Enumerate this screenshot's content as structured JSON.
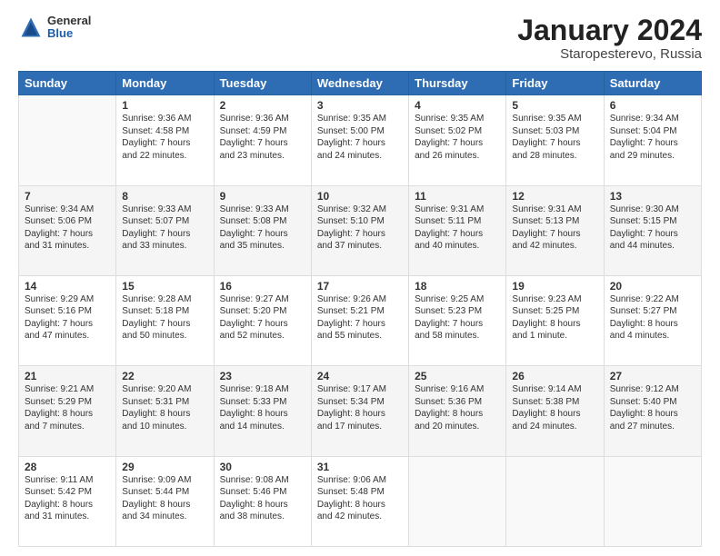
{
  "header": {
    "logo": {
      "general": "General",
      "blue": "Blue"
    },
    "title": "January 2024",
    "location": "Staropesterevo, Russia"
  },
  "days_of_week": [
    "Sunday",
    "Monday",
    "Tuesday",
    "Wednesday",
    "Thursday",
    "Friday",
    "Saturday"
  ],
  "weeks": [
    [
      {
        "day": "",
        "info": ""
      },
      {
        "day": "1",
        "info": "Sunrise: 9:36 AM\nSunset: 4:58 PM\nDaylight: 7 hours\nand 22 minutes."
      },
      {
        "day": "2",
        "info": "Sunrise: 9:36 AM\nSunset: 4:59 PM\nDaylight: 7 hours\nand 23 minutes."
      },
      {
        "day": "3",
        "info": "Sunrise: 9:35 AM\nSunset: 5:00 PM\nDaylight: 7 hours\nand 24 minutes."
      },
      {
        "day": "4",
        "info": "Sunrise: 9:35 AM\nSunset: 5:02 PM\nDaylight: 7 hours\nand 26 minutes."
      },
      {
        "day": "5",
        "info": "Sunrise: 9:35 AM\nSunset: 5:03 PM\nDaylight: 7 hours\nand 28 minutes."
      },
      {
        "day": "6",
        "info": "Sunrise: 9:34 AM\nSunset: 5:04 PM\nDaylight: 7 hours\nand 29 minutes."
      }
    ],
    [
      {
        "day": "7",
        "info": "Sunrise: 9:34 AM\nSunset: 5:06 PM\nDaylight: 7 hours\nand 31 minutes."
      },
      {
        "day": "8",
        "info": "Sunrise: 9:33 AM\nSunset: 5:07 PM\nDaylight: 7 hours\nand 33 minutes."
      },
      {
        "day": "9",
        "info": "Sunrise: 9:33 AM\nSunset: 5:08 PM\nDaylight: 7 hours\nand 35 minutes."
      },
      {
        "day": "10",
        "info": "Sunrise: 9:32 AM\nSunset: 5:10 PM\nDaylight: 7 hours\nand 37 minutes."
      },
      {
        "day": "11",
        "info": "Sunrise: 9:31 AM\nSunset: 5:11 PM\nDaylight: 7 hours\nand 40 minutes."
      },
      {
        "day": "12",
        "info": "Sunrise: 9:31 AM\nSunset: 5:13 PM\nDaylight: 7 hours\nand 42 minutes."
      },
      {
        "day": "13",
        "info": "Sunrise: 9:30 AM\nSunset: 5:15 PM\nDaylight: 7 hours\nand 44 minutes."
      }
    ],
    [
      {
        "day": "14",
        "info": "Sunrise: 9:29 AM\nSunset: 5:16 PM\nDaylight: 7 hours\nand 47 minutes."
      },
      {
        "day": "15",
        "info": "Sunrise: 9:28 AM\nSunset: 5:18 PM\nDaylight: 7 hours\nand 50 minutes."
      },
      {
        "day": "16",
        "info": "Sunrise: 9:27 AM\nSunset: 5:20 PM\nDaylight: 7 hours\nand 52 minutes."
      },
      {
        "day": "17",
        "info": "Sunrise: 9:26 AM\nSunset: 5:21 PM\nDaylight: 7 hours\nand 55 minutes."
      },
      {
        "day": "18",
        "info": "Sunrise: 9:25 AM\nSunset: 5:23 PM\nDaylight: 7 hours\nand 58 minutes."
      },
      {
        "day": "19",
        "info": "Sunrise: 9:23 AM\nSunset: 5:25 PM\nDaylight: 8 hours\nand 1 minute."
      },
      {
        "day": "20",
        "info": "Sunrise: 9:22 AM\nSunset: 5:27 PM\nDaylight: 8 hours\nand 4 minutes."
      }
    ],
    [
      {
        "day": "21",
        "info": "Sunrise: 9:21 AM\nSunset: 5:29 PM\nDaylight: 8 hours\nand 7 minutes."
      },
      {
        "day": "22",
        "info": "Sunrise: 9:20 AM\nSunset: 5:31 PM\nDaylight: 8 hours\nand 10 minutes."
      },
      {
        "day": "23",
        "info": "Sunrise: 9:18 AM\nSunset: 5:33 PM\nDaylight: 8 hours\nand 14 minutes."
      },
      {
        "day": "24",
        "info": "Sunrise: 9:17 AM\nSunset: 5:34 PM\nDaylight: 8 hours\nand 17 minutes."
      },
      {
        "day": "25",
        "info": "Sunrise: 9:16 AM\nSunset: 5:36 PM\nDaylight: 8 hours\nand 20 minutes."
      },
      {
        "day": "26",
        "info": "Sunrise: 9:14 AM\nSunset: 5:38 PM\nDaylight: 8 hours\nand 24 minutes."
      },
      {
        "day": "27",
        "info": "Sunrise: 9:12 AM\nSunset: 5:40 PM\nDaylight: 8 hours\nand 27 minutes."
      }
    ],
    [
      {
        "day": "28",
        "info": "Sunrise: 9:11 AM\nSunset: 5:42 PM\nDaylight: 8 hours\nand 31 minutes."
      },
      {
        "day": "29",
        "info": "Sunrise: 9:09 AM\nSunset: 5:44 PM\nDaylight: 8 hours\nand 34 minutes."
      },
      {
        "day": "30",
        "info": "Sunrise: 9:08 AM\nSunset: 5:46 PM\nDaylight: 8 hours\nand 38 minutes."
      },
      {
        "day": "31",
        "info": "Sunrise: 9:06 AM\nSunset: 5:48 PM\nDaylight: 8 hours\nand 42 minutes."
      },
      {
        "day": "",
        "info": ""
      },
      {
        "day": "",
        "info": ""
      },
      {
        "day": "",
        "info": ""
      }
    ]
  ]
}
